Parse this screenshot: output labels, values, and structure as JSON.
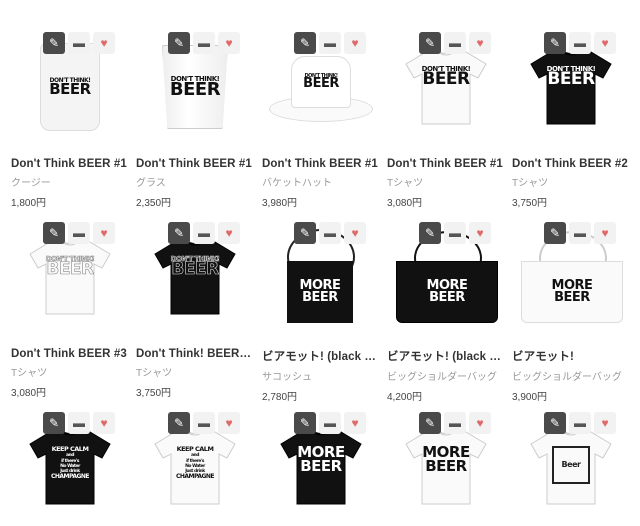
{
  "actions": {
    "edit_icon": "✎",
    "folder_icon": "▬",
    "fav_icon": "♥"
  },
  "products": [
    {
      "title": "Don't Think BEER #1",
      "category": "クージー",
      "price": "1,800円",
      "art": "koozie",
      "print": [
        "DON'T THINK!",
        "BEER"
      ]
    },
    {
      "title": "Don't Think BEER #1",
      "category": "グラス",
      "price": "2,350円",
      "art": "glass",
      "print": [
        "DON'T THINK!",
        "BEER"
      ]
    },
    {
      "title": "Don't Think BEER #1",
      "category": "バケットハット",
      "price": "3,980円",
      "art": "hat",
      "print": [
        "DON'T THINK!",
        "BEER"
      ]
    },
    {
      "title": "Don't Think BEER #1",
      "category": "Tシャツ",
      "price": "3,080円",
      "art": "tee-white",
      "print": [
        "DON'T THINK!",
        "BEER"
      ]
    },
    {
      "title": "Don't Think BEER #2",
      "category": "Tシャツ",
      "price": "3,750円",
      "art": "tee-black",
      "print": [
        "DON'T THINK!",
        "BEER"
      ]
    },
    {
      "title": "Don't Think BEER #3",
      "category": "Tシャツ",
      "price": "3,080円",
      "art": "tee-white-outline",
      "print": [
        "DON'T THINK!",
        "BEER"
      ]
    },
    {
      "title": "Don't Think! BEER …",
      "category": "Tシャツ",
      "price": "3,750円",
      "art": "tee-black-outline",
      "print": [
        "DON'T THINK!",
        "BEER"
      ]
    },
    {
      "title": "ビアモット! (black b…",
      "category": "サコッシュ",
      "price": "2,780円",
      "art": "sacoche",
      "print": [
        "MORE",
        "BEER"
      ]
    },
    {
      "title": "ビアモット! (black b…",
      "category": "ビッグショルダーバッグ",
      "price": "4,200円",
      "art": "bag-black",
      "print": [
        "MORE",
        "BEER"
      ]
    },
    {
      "title": "ビアモット!",
      "category": "ビッグショルダーバッグ",
      "price": "3,900円",
      "art": "bag-white",
      "print": [
        "MORE",
        "BEER"
      ]
    },
    {
      "title": "",
      "category": "",
      "price": "",
      "art": "tee-black-keepcalm",
      "print": [
        "KEEP CALM",
        "and",
        "if there's",
        "No Water",
        "Just drink",
        "CHAMPAGNE"
      ]
    },
    {
      "title": "",
      "category": "",
      "price": "",
      "art": "tee-white-keepcalm",
      "print": [
        "KEEP CALM",
        "and",
        "if there's",
        "No Water",
        "Just drink",
        "CHAMPAGNE"
      ]
    },
    {
      "title": "",
      "category": "",
      "price": "",
      "art": "tee-black-more",
      "print": [
        "MORE",
        "BEER"
      ]
    },
    {
      "title": "",
      "category": "",
      "price": "",
      "art": "tee-white-more",
      "print": [
        "MORE",
        "BEER"
      ]
    },
    {
      "title": "",
      "category": "",
      "price": "",
      "art": "tee-white-logo",
      "print": [
        "Beer"
      ]
    }
  ]
}
